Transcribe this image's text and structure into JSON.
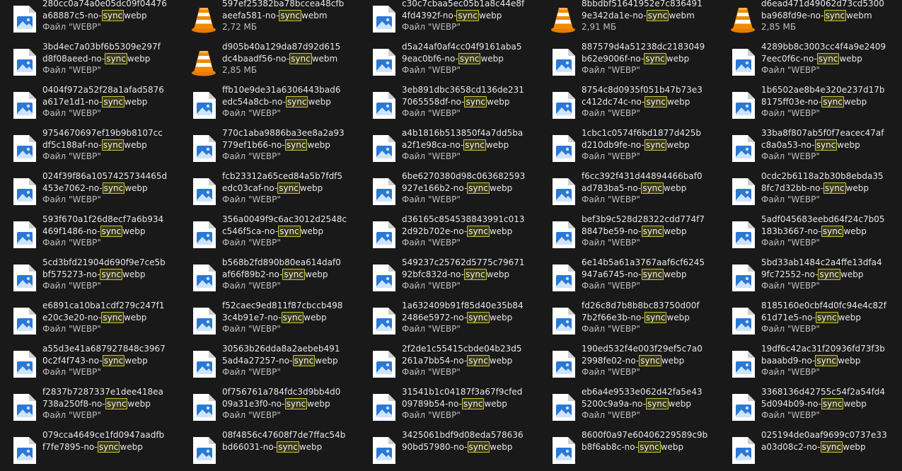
{
  "explorer": {
    "highlight_term": "sync",
    "accent": "#c9c23a",
    "files": [
      {
        "line1": "280cc0a74a0e05dc09f04476",
        "line2": "a68887c5-no-",
        "ext": "webp",
        "meta": "Файл \"WEBP\"",
        "icon": "image-file-icon"
      },
      {
        "line1": "597ef25382ba78bccea48cfb",
        "line2": "aeefa581-no-",
        "ext": "webm",
        "meta": "2,72 МБ",
        "icon": "vlc-cone-icon"
      },
      {
        "line1": "c30c7cbaa5ec05b1a8c44e8f",
        "line2": "4fd4392f-no-",
        "ext": "webp",
        "meta": "Файл \"WEBP\"",
        "icon": "image-file-icon"
      },
      {
        "line1": "8bbdbf51641952e7c836491",
        "line2": "9e342da1e-no-",
        "ext": "webm",
        "meta": "2,91 МБ",
        "icon": "vlc-cone-icon"
      },
      {
        "line1": "d6ead471d49062d73cd5300",
        "line2": "ba968fd9e-no-",
        "ext": "webm",
        "meta": "2,85 МБ",
        "icon": "vlc-cone-icon"
      },
      {
        "line1": "3bd4ec7a03bf6b5309e297f",
        "line2": "d8f08aeed-no-",
        "ext": "webp",
        "meta": "Файл \"WEBP\"",
        "icon": "image-file-icon"
      },
      {
        "line1": "d905b40a129da87d92d615",
        "line2": "dc4baadf56-no-",
        "ext": "webm",
        "meta": "2,85 МБ",
        "icon": "vlc-cone-icon"
      },
      {
        "line1": "d5a24af0af4cc04f9161aba5",
        "line2": "9eac0bf6-no-",
        "ext": "webp",
        "meta": "Файл \"WEBP\"",
        "icon": "image-file-icon"
      },
      {
        "line1": "887579d4a51238dc2183049",
        "line2": "b62e9006f-no-",
        "ext": "webp",
        "meta": "Файл \"WEBP\"",
        "icon": "image-file-icon"
      },
      {
        "line1": "4289bb8c3003cc4f4a9e2409",
        "line2": "7eec0f6c-no-",
        "ext": "webp",
        "meta": "Файл \"WEBP\"",
        "icon": "image-file-icon"
      },
      {
        "line1": "0404f972a52f28a1afad5876",
        "line2": "a617e1d1-no-",
        "ext": "webp",
        "meta": "Файл \"WEBP\"",
        "icon": "image-file-icon"
      },
      {
        "line1": "ffb10e9de31a6306443bad6",
        "line2": "edc54a8cb-no-",
        "ext": "webp",
        "meta": "Файл \"WEBP\"",
        "icon": "image-file-icon"
      },
      {
        "line1": "3eb891dbc3658cd136de231",
        "line2": "7065558df-no-",
        "ext": "webp",
        "meta": "Файл \"WEBP\"",
        "icon": "image-file-icon"
      },
      {
        "line1": "8754c8d0935f051b47b73e3",
        "line2": "c412dc74c-no-",
        "ext": "webp",
        "meta": "Файл \"WEBP\"",
        "icon": "image-file-icon"
      },
      {
        "line1": "1b6502ae8b4e320e237d17b",
        "line2": "8175ff03e-no-",
        "ext": "webp",
        "meta": "Файл \"WEBP\"",
        "icon": "image-file-icon"
      },
      {
        "line1": "9754670697ef19b9b8107cc",
        "line2": "df5c188af-no-",
        "ext": "webp",
        "meta": "Файл \"WEBP\"",
        "icon": "image-file-icon"
      },
      {
        "line1": "770c1aba9886ba3ee8a2a93",
        "line2": "779ef1b66-no-",
        "ext": "webp",
        "meta": "Файл \"WEBP\"",
        "icon": "image-file-icon"
      },
      {
        "line1": "a4b1816b513850f4a7dd5ba",
        "line2": "a2f1e98ca-no-",
        "ext": "webp",
        "meta": "Файл \"WEBP\"",
        "icon": "image-file-icon"
      },
      {
        "line1": "1cbc1c0574f6bd1877d425b",
        "line2": "d210db9fe-no-",
        "ext": "webp",
        "meta": "Файл \"WEBP\"",
        "icon": "image-file-icon"
      },
      {
        "line1": "33ba8f807ab5f0f7eacec47af",
        "line2": "c8a0a53-no-",
        "ext": "webp",
        "meta": "Файл \"WEBP\"",
        "icon": "image-file-icon"
      },
      {
        "line1": "024f39f86a1057425734465d",
        "line2": "453e7062-no-",
        "ext": "webp",
        "meta": "Файл \"WEBP\"",
        "icon": "image-file-icon"
      },
      {
        "line1": "fcb23312a65ced84a5b7fdf5",
        "line2": "edc03caf-no-",
        "ext": "webp",
        "meta": "Файл \"WEBP\"",
        "icon": "image-file-icon"
      },
      {
        "line1": "6be6270380d98c063682593",
        "line2": "927e166b2-no-",
        "ext": "webp",
        "meta": "Файл \"WEBP\"",
        "icon": "image-file-icon"
      },
      {
        "line1": "f6cc392f431d44894466baf0",
        "line2": "ad783ba5-no-",
        "ext": "webp",
        "meta": "Файл \"WEBP\"",
        "icon": "image-file-icon"
      },
      {
        "line1": "0cdc2b6118a2b30b8ebda35",
        "line2": "8fc7d32bb-no-",
        "ext": "webp",
        "meta": "Файл \"WEBP\"",
        "icon": "image-file-icon"
      },
      {
        "line1": "593f670a1f26d8ecf7a6b934",
        "line2": "469f1486-no-",
        "ext": "webp",
        "meta": "Файл \"WEBP\"",
        "icon": "image-file-icon"
      },
      {
        "line1": "356a0049f9c6ac3012d2548c",
        "line2": "c546f5ca-no-",
        "ext": "webp",
        "meta": "Файл \"WEBP\"",
        "icon": "image-file-icon"
      },
      {
        "line1": "d36165c854538843991c013",
        "line2": "2d92b702e-no-",
        "ext": "webp",
        "meta": "Файл \"WEBP\"",
        "icon": "image-file-icon"
      },
      {
        "line1": "bef3b9c528d28322cdd774f7",
        "line2": "8847be59-no-",
        "ext": "webp",
        "meta": "Файл \"WEBP\"",
        "icon": "image-file-icon"
      },
      {
        "line1": "5adf045683eebd64f24c7b05",
        "line2": "183b3667-no-",
        "ext": "webp",
        "meta": "Файл \"WEBP\"",
        "icon": "image-file-icon"
      },
      {
        "line1": "5cd3bfd21904d690f9e7ce5b",
        "line2": "bf575273-no-",
        "ext": "webp",
        "meta": "Файл \"WEBP\"",
        "icon": "image-file-icon"
      },
      {
        "line1": "b568b2fd890b80ea614daf0",
        "line2": "af66f89b2-no-",
        "ext": "webp",
        "meta": "Файл \"WEBP\"",
        "icon": "image-file-icon"
      },
      {
        "line1": "549237c25762d5775c79671",
        "line2": "92bfc832d-no-",
        "ext": "webp",
        "meta": "Файл \"WEBP\"",
        "icon": "image-file-icon"
      },
      {
        "line1": "6e14b5a61a3767aaf6cf6245",
        "line2": "947a6745-no-",
        "ext": "webp",
        "meta": "Файл \"WEBP\"",
        "icon": "image-file-icon"
      },
      {
        "line1": "5bd33ab1484c2a4ffe13dfa4",
        "line2": "9fc72552-no-",
        "ext": "webp",
        "meta": "Файл \"WEBP\"",
        "icon": "image-file-icon"
      },
      {
        "line1": "e6891ca10ba1cdf279c247f1",
        "line2": "e20c3e20-no-",
        "ext": "webp",
        "meta": "Файл \"WEBP\"",
        "icon": "image-file-icon"
      },
      {
        "line1": "f52caec9ed811f87cbccb498",
        "line2": "3c4b91e7-no-",
        "ext": "webp",
        "meta": "Файл \"WEBP\"",
        "icon": "image-file-icon"
      },
      {
        "line1": "1a632409b91f85d40e35b84",
        "line2": "2486e5972-no-",
        "ext": "webp",
        "meta": "Файл \"WEBP\"",
        "icon": "image-file-icon"
      },
      {
        "line1": "fd26c8d7b8b8bc83750d00f",
        "line2": "7b2f66e3b-no-",
        "ext": "webp",
        "meta": "Файл \"WEBP\"",
        "icon": "image-file-icon"
      },
      {
        "line1": "8185160e0cbf4d0fc94e4c82f",
        "line2": "61d71e5-no-",
        "ext": "webp",
        "meta": "Файл \"WEBP\"",
        "icon": "image-file-icon"
      },
      {
        "line1": "a55d3e41a687927848c3967",
        "line2": "0c2f4f743-no-",
        "ext": "webp",
        "meta": "Файл \"WEBP\"",
        "icon": "image-file-icon"
      },
      {
        "line1": "30563b26dda8a2aebeb491",
        "line2": "5ad4a27257-no-",
        "ext": "webp",
        "meta": "Файл \"WEBP\"",
        "icon": "image-file-icon"
      },
      {
        "line1": "2f2de1c55415cbde04b23d5",
        "line2": "261a7bb54-no-",
        "ext": "webp",
        "meta": "Файл \"WEBP\"",
        "icon": "image-file-icon"
      },
      {
        "line1": "190ed532f4e003f29ef5c7a0",
        "line2": "2998fe02-no-",
        "ext": "webp",
        "meta": "Файл \"WEBP\"",
        "icon": "image-file-icon"
      },
      {
        "line1": "19df6c42ac31f20936fd73f3b",
        "line2": "baaabd9-no-",
        "ext": "webp",
        "meta": "Файл \"WEBP\"",
        "icon": "image-file-icon"
      },
      {
        "line1": "f2837b7287337e1dee418ea",
        "line2": "738a250f8-no-",
        "ext": "webp",
        "meta": "Файл \"WEBP\"",
        "icon": "image-file-icon"
      },
      {
        "line1": "0f756761a784fdc3d9bb4d0",
        "line2": "09a31e3f0-no-",
        "ext": "webp",
        "meta": "Файл \"WEBP\"",
        "icon": "image-file-icon"
      },
      {
        "line1": "31541b1c04187f3a67f9cfed",
        "line2": "09789b54-no-",
        "ext": "webp",
        "meta": "Файл \"WEBP\"",
        "icon": "image-file-icon"
      },
      {
        "line1": "eb6a4e9533e062d42fa5e43",
        "line2": "5200c9a9a-no-",
        "ext": "webp",
        "meta": "Файл \"WEBP\"",
        "icon": "image-file-icon"
      },
      {
        "line1": "3368136d42755c54f2a54fd4",
        "line2": "5d094b09-no-",
        "ext": "webp",
        "meta": "Файл \"WEBP\"",
        "icon": "image-file-icon"
      },
      {
        "line1": "079cca4649ce1fd0947aadfb",
        "line2": "f7fe7895-no-",
        "ext": "webp",
        "meta": "",
        "icon": "image-file-icon"
      },
      {
        "line1": "08f4856c47608f7de7ffac54b",
        "line2": "bd66031-no-",
        "ext": "webp",
        "meta": "",
        "icon": "image-file-icon"
      },
      {
        "line1": "3425061bdf9d08eda578636",
        "line2": "90bd57980-no-",
        "ext": "webp",
        "meta": "",
        "icon": "image-file-icon"
      },
      {
        "line1": "8600f0a97e60406229589c9b",
        "line2": "b8f6ab8c-no-",
        "ext": "webp",
        "meta": "",
        "icon": "image-file-icon"
      },
      {
        "line1": "025194de0aaf9699c0737e33",
        "line2": "a03d08c2-no-",
        "ext": "webp",
        "meta": "",
        "icon": "image-file-icon"
      }
    ]
  }
}
